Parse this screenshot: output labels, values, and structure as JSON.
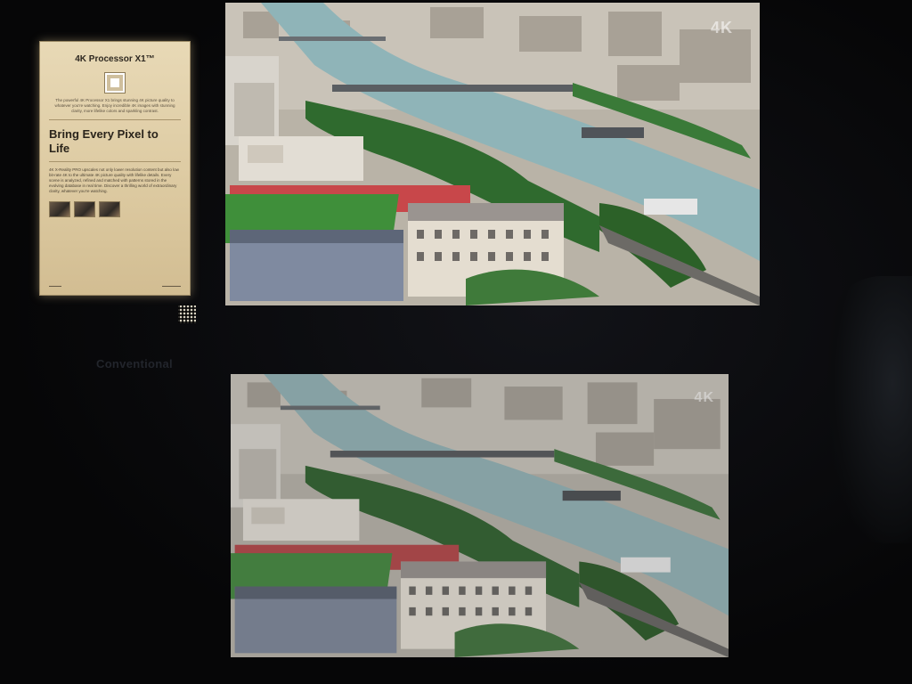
{
  "placard": {
    "title": "4K Processor X1™",
    "intro": "The powerful 4K Processor X1 brings stunning 4K picture quality to whatever you're watching. Enjoy incredible 4K images with stunning clarity, more lifelike colors and sparkling contrast.",
    "headline": "Bring Every Pixel to Life",
    "body": "4K X-Reality PRO upscales not only lower resolution content but also low bit-rate 4K to the ultimate 4K picture quality with lifelike details. Every scene is analyzed, refined and matched with patterns stored in the evolving database in real time. Discover a thrilling world of extraordinary clarity, whatever you're watching."
  },
  "comparison_label": "Conventional",
  "screens": {
    "top_watermark": "4K",
    "bottom_watermark": "4K"
  },
  "colors": {
    "placard_bg": "#dcc9a0",
    "river": "#8fb4b8",
    "grass": "#3f8f3a",
    "track": "#c8474a"
  }
}
